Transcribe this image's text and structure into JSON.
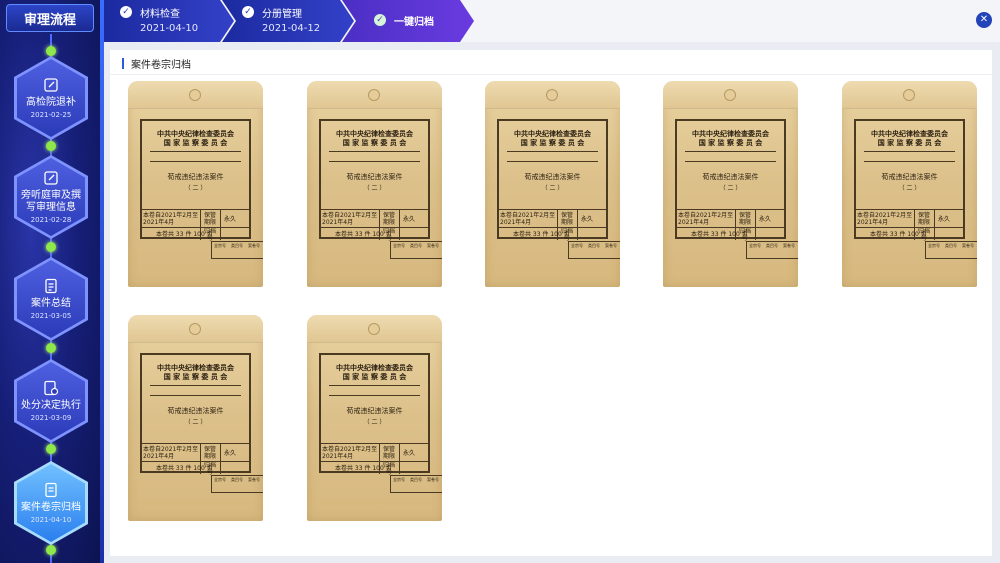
{
  "sidebar": {
    "title": "审理流程",
    "items": [
      {
        "label": "高检院退补",
        "date": "2021-02-25",
        "icon": "edit-icon",
        "active": false
      },
      {
        "label": "旁听庭审及撰写审理信息",
        "date": "2021-02-28",
        "icon": "edit-icon",
        "active": false
      },
      {
        "label": "案件总结",
        "date": "2021-03-05",
        "icon": "document-list-icon",
        "active": false
      },
      {
        "label": "处分决定执行",
        "date": "2021-03-09",
        "icon": "document-gear-icon",
        "active": false
      },
      {
        "label": "案件卷宗归档",
        "date": "2021-04-10",
        "icon": "archive-icon",
        "active": true
      }
    ]
  },
  "steps": [
    {
      "name": "材料检查",
      "date": "2021-04-10",
      "status": "done"
    },
    {
      "name": "分册管理",
      "date": "2021-04-12",
      "status": "done"
    },
    {
      "name": "一键归档",
      "status": "current"
    }
  ],
  "section": {
    "title": "案件卷宗归档"
  },
  "envelope": {
    "org_line1": "中共中央纪律检查委员会",
    "org_line2": "国 家 监 察 委 员 会",
    "case_title": "荀戒违纪违法案件",
    "volume": "（ 二 ）",
    "period": "本卷自2021年2月至2021年4月",
    "keep_label": "保管期限",
    "keep_value": "永久",
    "count": "本卷共 33 件  100 页",
    "archive_no_label": "归档号",
    "col1": "全宗号",
    "col2": "类目号",
    "col3": "案卷号"
  },
  "colors": {
    "accent": "#2b5bdc",
    "sidebar_bg": "#161f78",
    "step_bg": "#1c2aa0",
    "timeline_dot": "#8ee84a"
  }
}
